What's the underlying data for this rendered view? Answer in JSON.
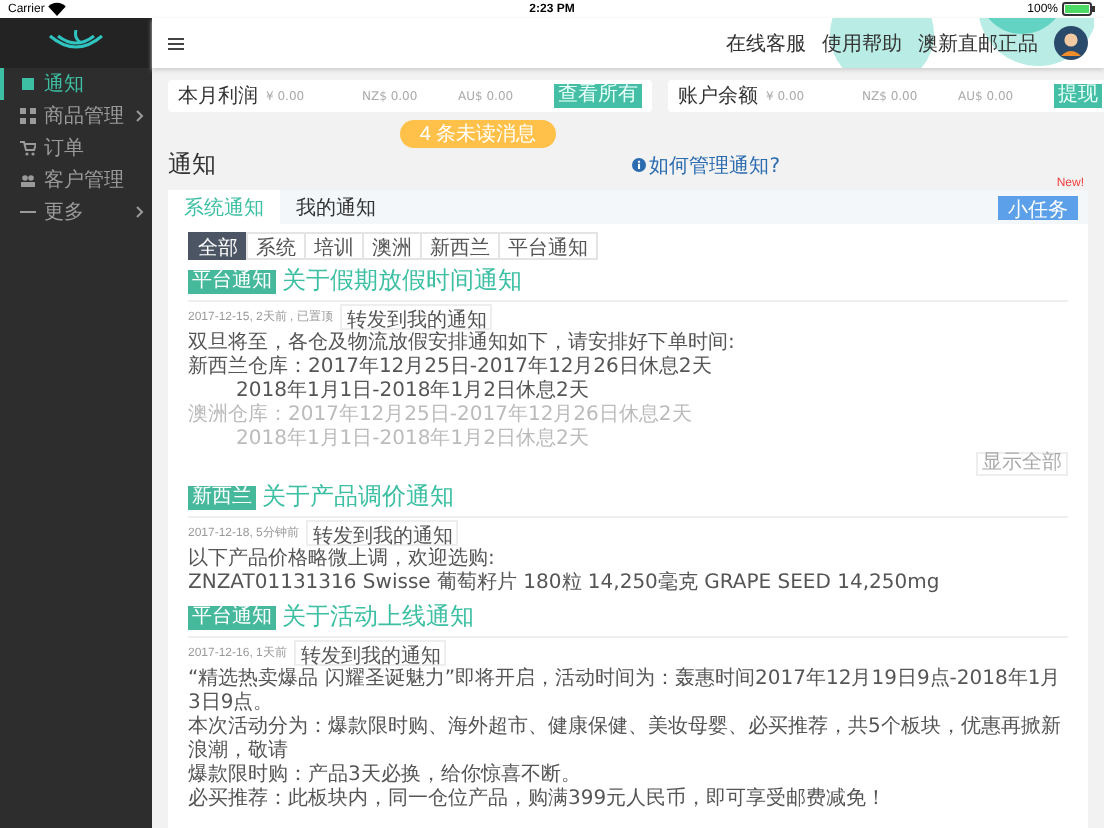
{
  "status_bar": {
    "carrier": "Carrier",
    "time": "2:23 PM",
    "battery": "100%"
  },
  "sidebar": {
    "items": [
      {
        "label": "通知",
        "selected": true,
        "expandable": false
      },
      {
        "label": "商品管理",
        "selected": false,
        "expandable": true
      },
      {
        "label": "订单",
        "selected": false,
        "expandable": false
      },
      {
        "label": "客户管理",
        "selected": false,
        "expandable": false
      },
      {
        "label": "更多",
        "selected": false,
        "expandable": true
      }
    ]
  },
  "topbar": {
    "links": [
      "在线客服",
      "使用帮助"
    ],
    "user": "澳新直邮正品"
  },
  "stat_cards": [
    {
      "label": "本月利润",
      "values": [
        "¥ 0.00",
        "NZ$ 0.00",
        "AU$ 0.00"
      ],
      "button": "查看所有"
    },
    {
      "label": "账户余额",
      "values": [
        "¥ 0.00",
        "NZ$ 0.00",
        "AU$ 0.00"
      ],
      "button": "提现"
    }
  ],
  "unread_pill": "4 条未读消息",
  "page_title": "通知",
  "help_link": "如何管理通知?",
  "tabs": [
    {
      "label": "系统通知",
      "selected": true
    },
    {
      "label": "我的通知",
      "selected": false
    }
  ],
  "task_button": "小任务",
  "new_badge": "New!",
  "filters": [
    {
      "label": "全部",
      "selected": true
    },
    {
      "label": "系统",
      "selected": false
    },
    {
      "label": "培训",
      "selected": false
    },
    {
      "label": "澳洲",
      "selected": false
    },
    {
      "label": "新西兰",
      "selected": false
    },
    {
      "label": "平台通知",
      "selected": false
    }
  ],
  "notices": [
    {
      "tag": "平台通知",
      "title": "关于假期放假时间通知",
      "meta": "2017-12-15, 2天前 , 已置顶",
      "forward": "转发到我的通知",
      "show_all": "显示全部",
      "lines": [
        {
          "text": "双旦将至，各仓及物流放假安排通知如下，请安排好下单时间:",
          "kind": "text",
          "faded": false
        },
        {
          "text": "新西兰仓库：2017年12月25日-2017年12月26日休息2天",
          "kind": "text",
          "faded": false
        },
        {
          "text": "2018年1月1日-2018年1月2日休息2天",
          "kind": "indent",
          "faded": false
        },
        {
          "text": "澳洲仓库：2017年12月25日-2017年12月26日休息2天",
          "kind": "text",
          "faded": true
        },
        {
          "text": "2018年1月1日-2018年1月2日休息2天",
          "kind": "indent",
          "faded": true
        }
      ]
    },
    {
      "tag": "新西兰",
      "title": "关于产品调价通知",
      "meta": "2017-12-18, 5分钟前",
      "forward": "转发到我的通知",
      "lines": [
        {
          "text": "以下产品价格略微上调，欢迎选购:",
          "kind": "text",
          "faded": false
        },
        {
          "text": "ZNZAT01131316    Swisse 葡萄籽片 180粒 14,250毫克 GRAPE SEED 14,250mg",
          "kind": "text",
          "faded": false
        }
      ]
    },
    {
      "tag": "平台通知",
      "title": "关于活动上线通知",
      "meta": "2017-12-16, 1天前",
      "forward": "转发到我的通知",
      "lines": [
        {
          "text": "“精选热卖爆品 闪耀圣诞魅力”即将开启，活动时间为：轰惠时间2017年12月19日9点-2018年1月3日9点。",
          "kind": "text",
          "faded": false
        },
        {
          "text": "本次活动分为：爆款限时购、海外超市、健康保健、美妆母婴、必买推荐，共5个板块，优惠再掀新浪潮，敬请",
          "kind": "text",
          "faded": false
        },
        {
          "text": "爆款限时购：产品3天必换，给你惊喜不断。",
          "kind": "text",
          "faded": false
        },
        {
          "text": "必买推荐：此板块内，同一仓位产品，购满399元人民币，即可享受邮费减免！",
          "kind": "text",
          "faded": false
        }
      ]
    }
  ]
}
